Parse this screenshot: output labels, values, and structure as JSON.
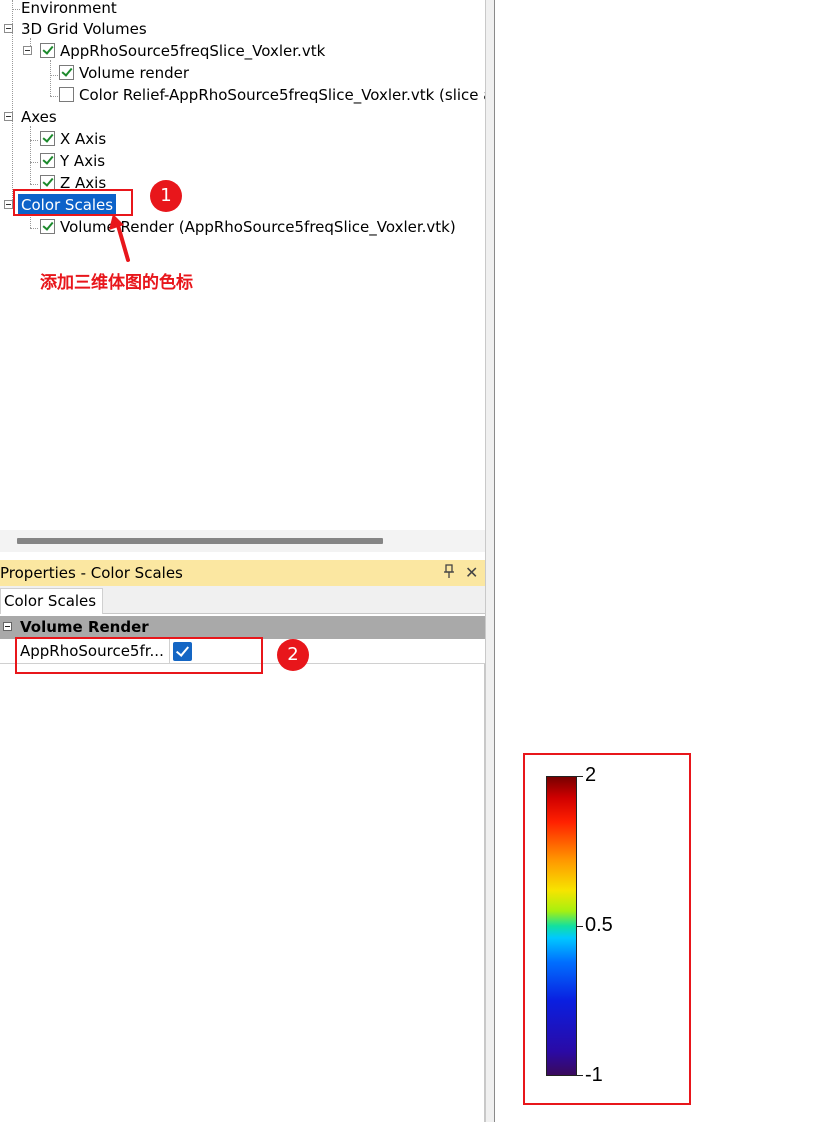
{
  "tree": {
    "environment": "Environment",
    "grid_volumes": "3D Grid Volumes",
    "vtk_file": "AppRhoSource5freqSlice_Voxler.vtk",
    "volume_render": "Volume render",
    "color_relief": "Color Relief-AppRhoSource5freqSlice_Voxler.vtk (slice a",
    "axes": "Axes",
    "x_axis": "X Axis",
    "y_axis": "Y Axis",
    "z_axis": "Z Axis",
    "color_scales": "Color Scales",
    "volume_render_scale": "Volume Render (AppRhoSource5freqSlice_Voxler.vtk)"
  },
  "annotation": {
    "step1": "1",
    "step2": "2",
    "note": "添加三维体图的色标"
  },
  "properties": {
    "header_title": "Properties - Color Scales",
    "pin_glyph": "ᵖ",
    "close_glyph": "✕",
    "tab": "Color Scales",
    "category": "Volume Render",
    "row_name": "AppRhoSource5fr...",
    "row_checked": true
  },
  "colorbar": {
    "max_label": "2",
    "mid_label": "0.5",
    "min_label": "-1",
    "max": 2,
    "mid": 0.5,
    "min": -1
  },
  "colors": {
    "accent_red": "#e8161b",
    "selection_blue": "#0c62c9",
    "panel_header": "#fbe7a1"
  }
}
